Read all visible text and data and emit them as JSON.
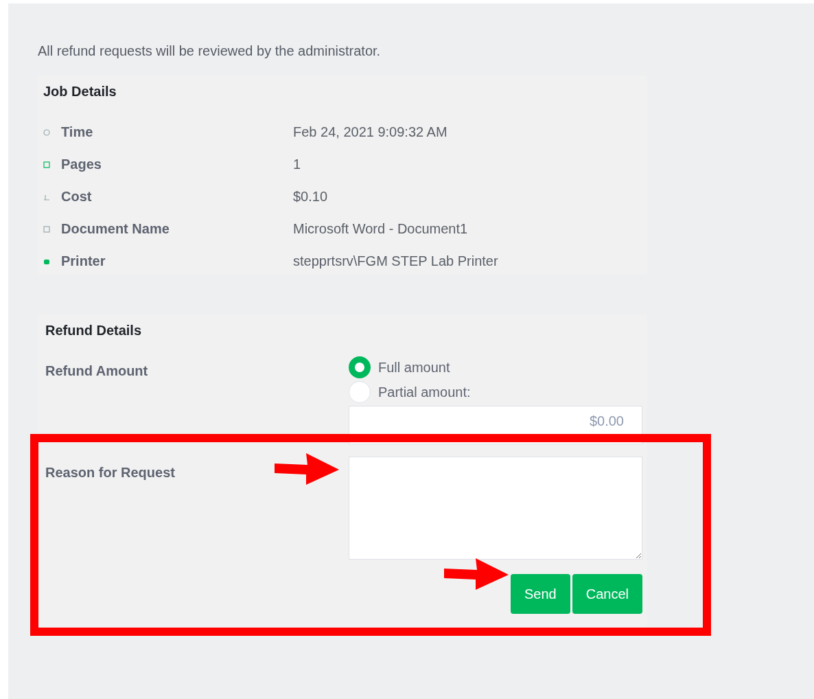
{
  "notice": "All refund requests will be reviewed by the administrator.",
  "job_details": {
    "title": "Job Details",
    "rows": [
      {
        "label": "Time",
        "value": "Feb 24, 2021 9:09:32 AM"
      },
      {
        "label": "Pages",
        "value": "1"
      },
      {
        "label": "Cost",
        "value": "$0.10"
      },
      {
        "label": "Document Name",
        "value": "Microsoft Word - Document1"
      },
      {
        "label": "Printer",
        "value": "stepprtsrv\\FGM STEP Lab Printer"
      }
    ]
  },
  "refund_details": {
    "title": "Refund Details",
    "amount_label": "Refund Amount",
    "options": [
      {
        "label": "Full amount",
        "selected": true
      },
      {
        "label": "Partial amount:",
        "selected": false
      }
    ],
    "partial_amount_field": {
      "placeholder": "$0.00"
    },
    "reason_label": "Reason for Request",
    "buttons": [
      {
        "label": "Send"
      },
      {
        "label": "Cancel"
      }
    ]
  },
  "annotations": [
    {
      "kind": "box"
    },
    {
      "kind": "arrow"
    },
    {
      "kind": "arrow"
    }
  ]
}
